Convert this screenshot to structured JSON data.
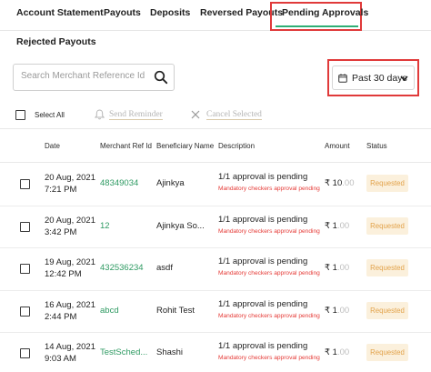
{
  "tabs": [
    {
      "label": "Account Statement"
    },
    {
      "label": "Payouts"
    },
    {
      "label": "Deposits"
    },
    {
      "label": "Reversed Payouts"
    },
    {
      "label": "Pending Approvals"
    },
    {
      "label": "Rejected Payouts"
    }
  ],
  "active_tab": "Pending Approvals",
  "accent_color": "#2fae75",
  "highlight_color": "#e03a3a",
  "search": {
    "placeholder": "Search Merchant Reference Id",
    "value": "",
    "icon": "search-icon"
  },
  "date_filter": {
    "label": "Past 30 days",
    "icon": "calendar-icon"
  },
  "bulk_actions": {
    "select_all": "Select All",
    "send_reminder": "Send Reminder",
    "cancel_selected": "Cancel Selected"
  },
  "table": {
    "columns": [
      "Date",
      "Merchant Ref Id",
      "Beneficiary Name",
      "Description",
      "Amount",
      "Status"
    ],
    "rows": [
      {
        "date": "20 Aug, 2021",
        "time": "7:21 PM",
        "ref": "48349034",
        "name": "Ajinkya",
        "desc": "1/1 approval is pending",
        "desc_sub": "Mandatory checkers approval pending",
        "amount_main": "₹ 10",
        "amount_tail": ".00",
        "status": "Requested"
      },
      {
        "date": "20 Aug, 2021",
        "time": "3:42 PM",
        "ref": "12",
        "name": "Ajinkya So...",
        "desc": "1/1 approval is pending",
        "desc_sub": "Mandatory checkers approval pending",
        "amount_main": "₹ 1",
        "amount_tail": ".00",
        "status": "Requested"
      },
      {
        "date": "19 Aug, 2021",
        "time": "12:42 PM",
        "ref": "432536234",
        "name": "asdf",
        "desc": "1/1 approval is pending",
        "desc_sub": "Mandatory checkers approval pending",
        "amount_main": "₹ 1",
        "amount_tail": ".00",
        "status": "Requested"
      },
      {
        "date": "16 Aug, 2021",
        "time": "2:44 PM",
        "ref": "abcd",
        "name": "Rohit Test",
        "desc": "1/1 approval is pending",
        "desc_sub": "Mandatory checkers approval pending",
        "amount_main": "₹ 1",
        "amount_tail": ".00",
        "status": "Requested"
      },
      {
        "date": "14 Aug, 2021",
        "time": "9:03 AM",
        "ref": "TestSched...",
        "name": "Shashi",
        "desc": "1/1 approval is pending",
        "desc_sub": "Mandatory checkers approval pending",
        "amount_main": "₹ 1",
        "amount_tail": ".00",
        "status": "Requested"
      }
    ]
  }
}
